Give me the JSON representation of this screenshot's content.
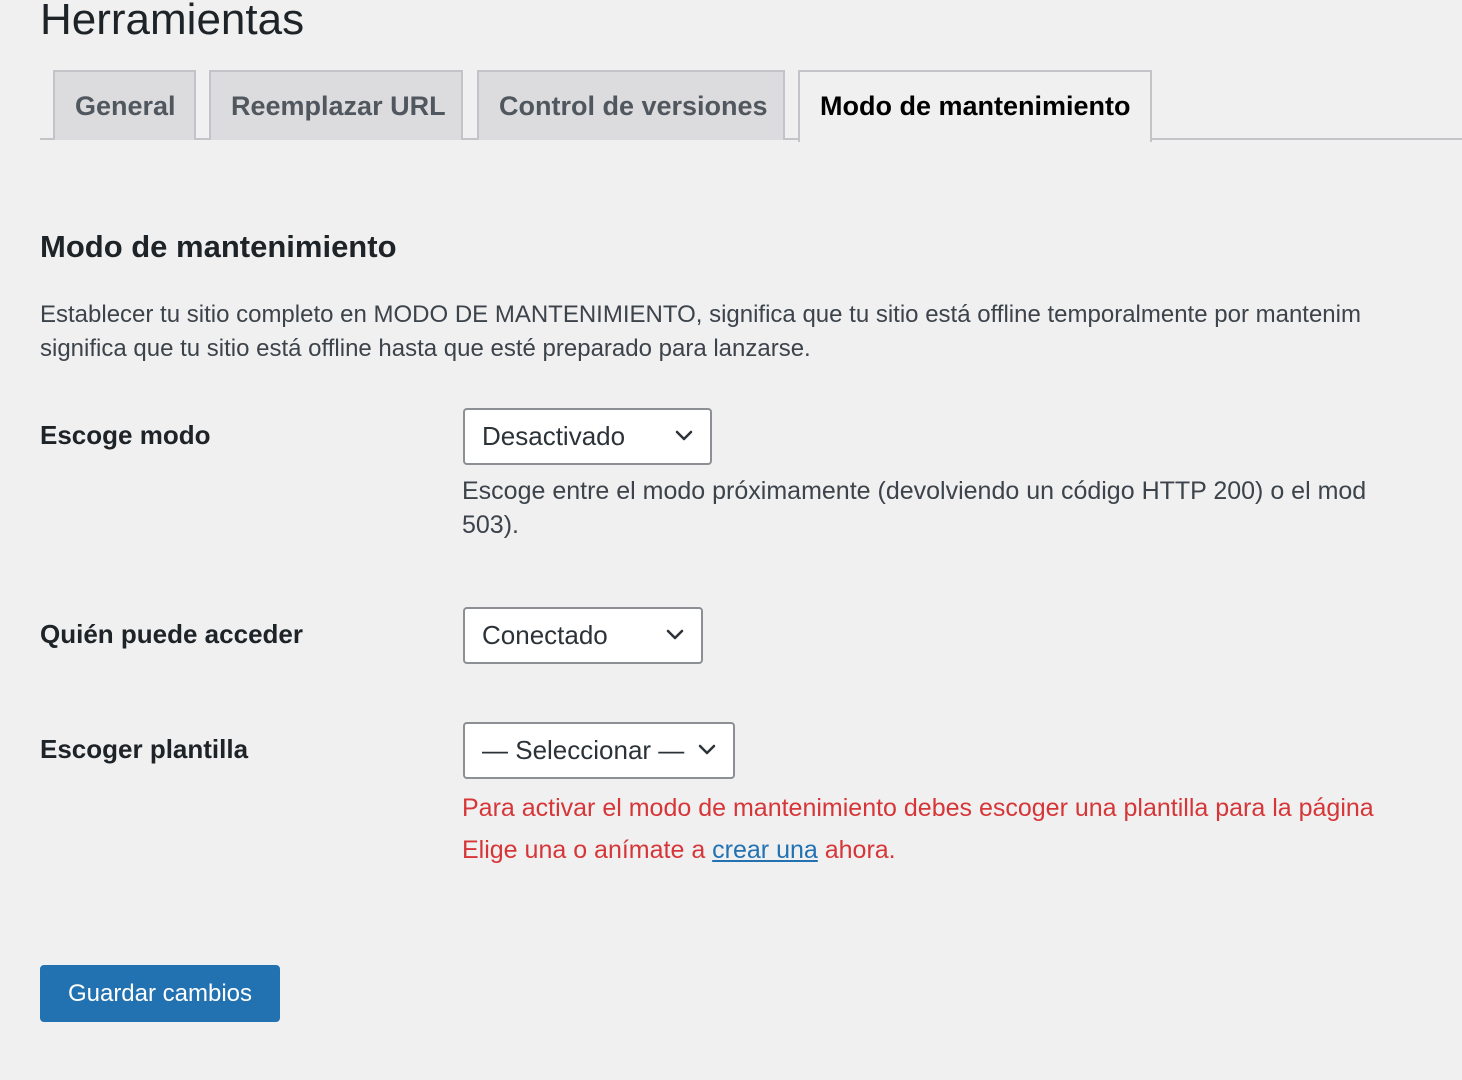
{
  "page": {
    "title": "Herramientas"
  },
  "tabs": [
    {
      "label": "General",
      "active": false
    },
    {
      "label": "Reemplazar URL",
      "active": false
    },
    {
      "label": "Control de versiones",
      "active": false
    },
    {
      "label": "Modo de mantenimiento",
      "active": true
    }
  ],
  "section": {
    "title": "Modo de mantenimiento",
    "intro_line1": "Establecer tu sitio completo en MODO DE MANTENIMIENTO, significa que tu sitio está offline temporalmente por mantenim",
    "intro_line2": "significa que tu sitio está offline hasta que esté preparado para lanzarse."
  },
  "fields": {
    "mode": {
      "label": "Escoge modo",
      "selected": "Desactivado",
      "desc_line1": "Escoge entre el modo próximamente (devolviendo un código HTTP 200) o el mod",
      "desc_line2": "503)."
    },
    "access": {
      "label": "Quién puede acceder",
      "selected": "Conectado"
    },
    "template": {
      "label": "Escoger plantilla",
      "selected": "— Seleccionar —",
      "error_line1": "Para activar el modo de mantenimiento debes escoger una plantilla para la página",
      "error_line2_before": "Elige una o anímate a ",
      "error_link": "crear una",
      "error_line2_after": " ahora."
    }
  },
  "actions": {
    "save_label": "Guardar cambios"
  },
  "icons": {
    "select_arrow": "chevron-down-icon"
  },
  "colors": {
    "background": "#f0f0f1",
    "primary": "#2271b1",
    "error": "#d63638",
    "tab_inactive_bg": "#dcdcde"
  }
}
